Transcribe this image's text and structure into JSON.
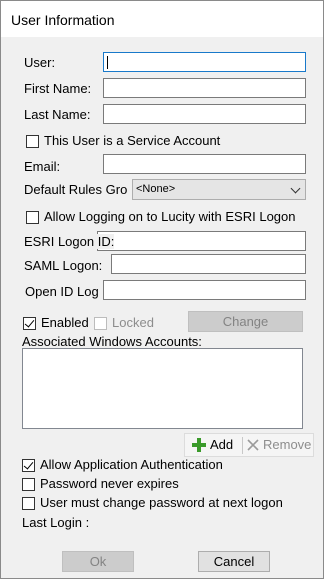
{
  "window": {
    "title": "User Information"
  },
  "form": {
    "user_label": "User:",
    "user_value": "",
    "first_name_label": "First Name:",
    "first_name_value": "",
    "last_name_label": "Last Name:",
    "last_name_value": "",
    "service_account_label": "This User is a Service Account",
    "service_account_checked": false,
    "email_label": "Email:",
    "email_value": "",
    "default_rules_label": "Default Rules Gro",
    "default_rules_value": "<None>",
    "esri_logon_checkbox_label": "Allow Logging on to Lucity with ESRI Logon",
    "esri_logon_checked": false,
    "esri_logon_id_label": "ESRI Logon ID:",
    "esri_logon_id_value": "",
    "saml_logon_label": "SAML Logon:",
    "saml_logon_value": "",
    "open_id_label": "Open ID Log",
    "open_id_value": ""
  },
  "status": {
    "enabled_label": "Enabled",
    "enabled_checked": true,
    "locked_label": "Locked",
    "locked_checked": false,
    "change_button": "Change"
  },
  "windows_accounts": {
    "label": "Associated Windows Accounts:",
    "items": [],
    "add_button": "Add",
    "remove_button": "Remove"
  },
  "options": {
    "allow_app_auth_label": "Allow Application Authentication",
    "allow_app_auth_checked": true,
    "password_never_expires_label": "Password never expires",
    "password_never_expires_checked": false,
    "must_change_password_label": "User must change password at next logon",
    "must_change_password_checked": false,
    "last_login_label": "Last Login :"
  },
  "footer": {
    "ok_button": "Ok",
    "cancel_button": "Cancel"
  },
  "icons": {
    "add": "plus-icon",
    "remove": "x-icon"
  },
  "colors": {
    "window_bg": "#f0f0f0",
    "focus_border": "#1979ca",
    "add_icon": "#3a9a2a",
    "disabled_text": "#838383"
  }
}
